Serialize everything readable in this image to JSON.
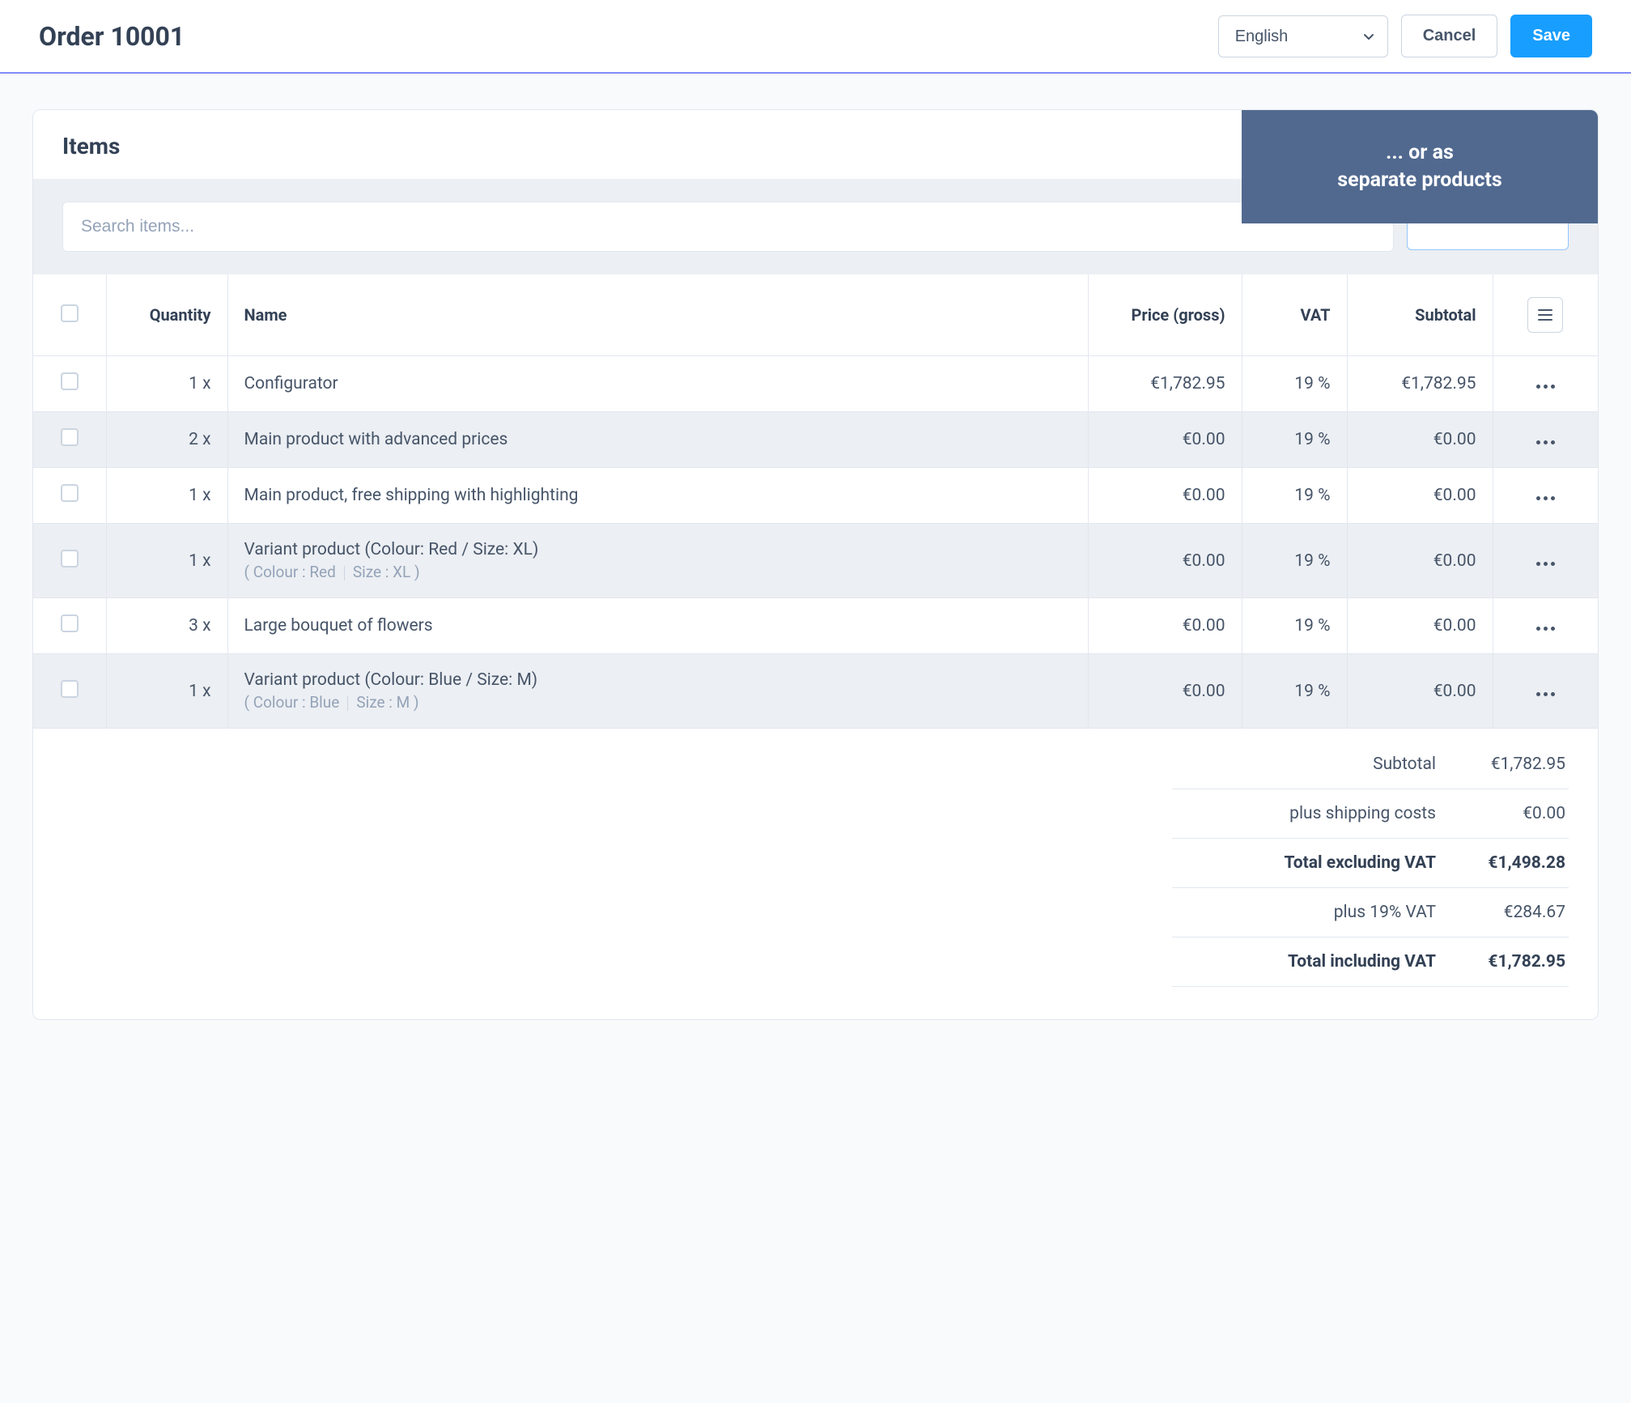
{
  "header": {
    "title": "Order 10001",
    "language_value": "English",
    "cancel_label": "Cancel",
    "save_label": "Save"
  },
  "callout": {
    "line1": "... or as",
    "line2": "separate products"
  },
  "card": {
    "title": "Items",
    "search_placeholder": "Search items..."
  },
  "columns": {
    "quantity": "Quantity",
    "name": "Name",
    "price": "Price (gross)",
    "vat": "VAT",
    "subtotal": "Subtotal"
  },
  "rows": [
    {
      "qty": "1 x",
      "name": "Configurator",
      "price": "€1,782.95",
      "vat": "19 %",
      "subtotal": "€1,782.95",
      "variant": null
    },
    {
      "qty": "2 x",
      "name": "Main product with advanced prices",
      "price": "€0.00",
      "vat": "19 %",
      "subtotal": "€0.00",
      "variant": null
    },
    {
      "qty": "1 x",
      "name": "Main product, free shipping with highlighting",
      "price": "€0.00",
      "vat": "19 %",
      "subtotal": "€0.00",
      "variant": null
    },
    {
      "qty": "1 x",
      "name": "Variant product (Colour: Red / Size: XL)",
      "price": "€0.00",
      "vat": "19 %",
      "subtotal": "€0.00",
      "variant": {
        "a": "Colour : Red",
        "b": "Size : XL"
      }
    },
    {
      "qty": "3 x",
      "name": "Large bouquet of flowers",
      "price": "€0.00",
      "vat": "19 %",
      "subtotal": "€0.00",
      "variant": null
    },
    {
      "qty": "1 x",
      "name": "Variant product (Colour: Blue / Size: M)",
      "price": "€0.00",
      "vat": "19 %",
      "subtotal": "€0.00",
      "variant": {
        "a": "Colour : Blue",
        "b": "Size : M"
      }
    }
  ],
  "summary": [
    {
      "label": "Subtotal",
      "value": "€1,782.95",
      "bold": false
    },
    {
      "label": "plus shipping costs",
      "value": "€0.00",
      "bold": false
    },
    {
      "label": "Total excluding VAT",
      "value": "€1,498.28",
      "bold": true
    },
    {
      "label": "plus 19% VAT",
      "value": "€284.67",
      "bold": false
    },
    {
      "label": "Total including VAT",
      "value": "€1,782.95",
      "bold": true
    }
  ]
}
